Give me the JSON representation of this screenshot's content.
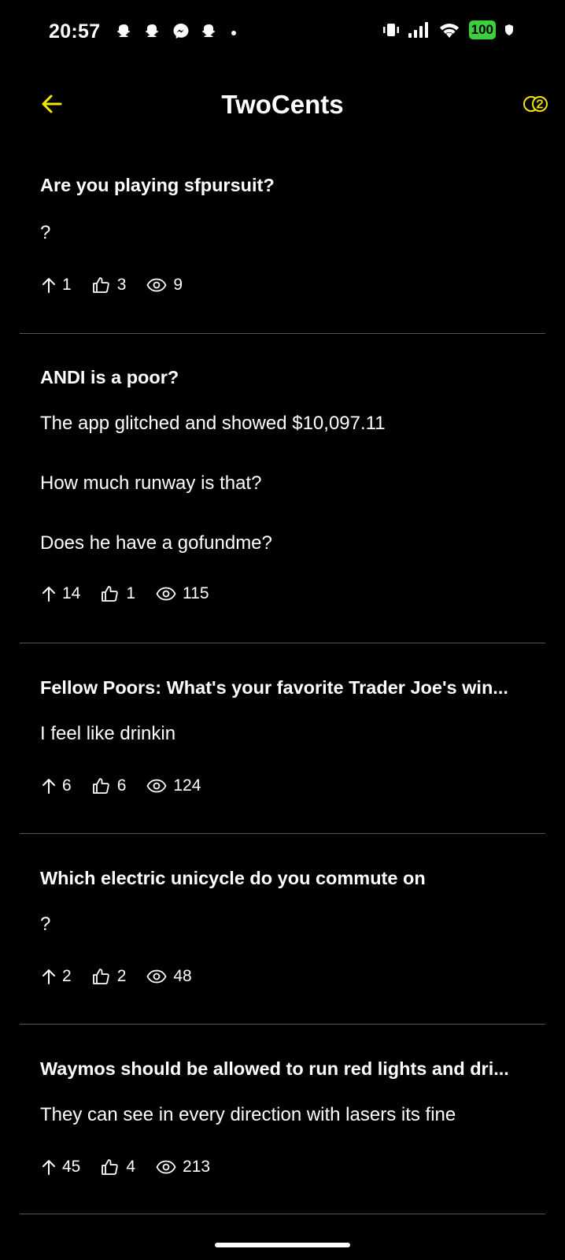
{
  "status_bar": {
    "time": "20:57",
    "battery": "100",
    "left_icons": [
      "snapchat-icon",
      "snapchat-icon",
      "messenger-icon",
      "snapchat-icon",
      "dot-icon"
    ],
    "right_icons": [
      "vibrate-icon",
      "signal-icon",
      "wifi-icon",
      "battery-icon",
      "shield-icon"
    ]
  },
  "header": {
    "title": "TwoCents",
    "back_icon": "arrow-left-icon",
    "coins_icon": "coins-icon",
    "accent_color": "#f5e500"
  },
  "posts": [
    {
      "title": "Are you playing sfpursuit?",
      "body": [
        "?"
      ],
      "upvotes": "1",
      "likes": "3",
      "views": "9"
    },
    {
      "title": "ANDI is a poor?",
      "body": [
        "The app glitched and showed $10,097.11",
        "How much runway is that?",
        "Does he have a gofundme?"
      ],
      "upvotes": "14",
      "likes": "1",
      "views": "115"
    },
    {
      "title": "Fellow Poors: What's your favorite Trader Joe's win...",
      "body": [
        "I feel like drinkin"
      ],
      "upvotes": "6",
      "likes": "6",
      "views": "124"
    },
    {
      "title": "Which electric unicycle do you commute on",
      "body": [
        "?"
      ],
      "upvotes": "2",
      "likes": "2",
      "views": "48"
    },
    {
      "title": "Waymos should be allowed to run red lights and dri...",
      "body": [
        "They can see in every direction with lasers its fine"
      ],
      "upvotes": "45",
      "likes": "4",
      "views": "213"
    }
  ]
}
